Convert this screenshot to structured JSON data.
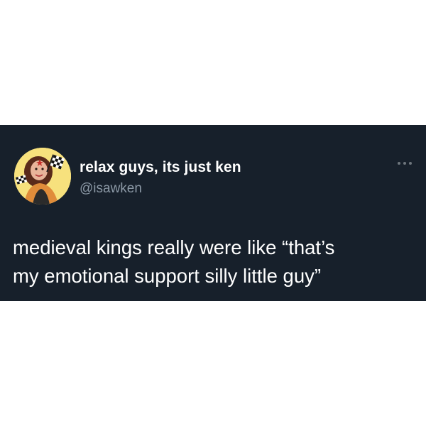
{
  "tweet": {
    "author": {
      "display_name": "relax guys, its just ken",
      "handle": "@isawken",
      "avatar_icon": "user-avatar-photo"
    },
    "more_icon": "more-options-icon",
    "text": "medieval kings really were like “that’s\nmy emotional support silly little guy”"
  },
  "colors": {
    "page_background": "#ffffff",
    "card_background": "#17202b",
    "primary_text": "#ffffff",
    "secondary_text": "#8b98a5",
    "avatar_background": "#f7e17d"
  }
}
